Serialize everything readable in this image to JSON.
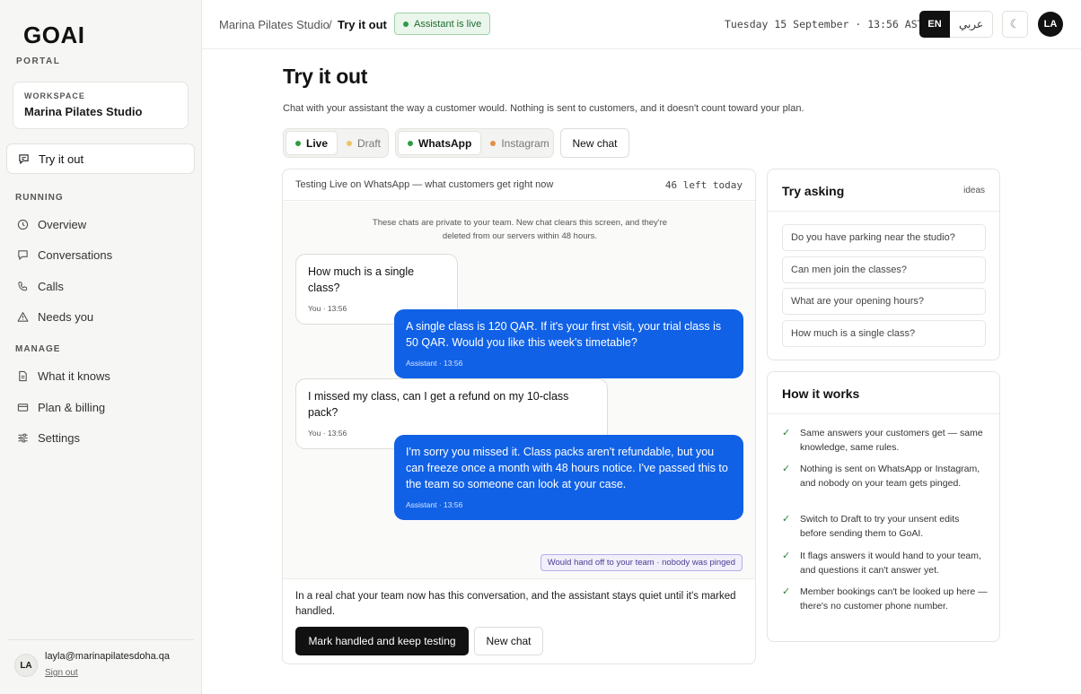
{
  "sidebar": {
    "logo": "GOAI",
    "logo_sub": "PORTAL",
    "workspace_label": "WORKSPACE",
    "workspace_name": "Marina Pilates Studio",
    "active_item": "Try it out",
    "section_running": "RUNNING",
    "running_items": [
      "Overview",
      "Conversations",
      "Calls",
      "Needs you"
    ],
    "section_manage": "MANAGE",
    "manage_items": [
      "What it knows",
      "Plan & billing",
      "Settings"
    ],
    "user_initials": "LA",
    "user_email": "layla@marinapilatesdoha.qa",
    "sign_out": "Sign out"
  },
  "topbar": {
    "crumb_parent": "Marina Pilates Studio",
    "crumb_sep": "/",
    "crumb_current": "Try it out",
    "live_badge": "Assistant is live",
    "datetime": "Tuesday 15 September · 13:56 AST",
    "lang_en": "EN",
    "lang_ar": "عربي",
    "theme_icon": "☾",
    "avatar": "LA"
  },
  "main": {
    "title": "Try it out",
    "subtitle": "Chat with your assistant the way a customer would. Nothing is sent to customers, and it doesn't count toward your plan.",
    "mode_live": "Live",
    "mode_draft": "Draft",
    "channel_whatsapp": "WhatsApp",
    "channel_instagram": "Instagram",
    "new_chat": "New chat"
  },
  "chat": {
    "header": "Testing Live on WhatsApp — what customers get right now",
    "remaining": "46 left today",
    "privacy_line1": "These chats are private to your team. New chat clears this screen, and they're",
    "privacy_line2": "deleted from our servers within 48 hours.",
    "messages": [
      {
        "role": "user",
        "text": "How much is a single class?",
        "meta": "You · 13:56"
      },
      {
        "role": "bot",
        "text": "A single class is 120 QAR. If it's your first visit, your trial class is 50 QAR. Would you like this week's timetable?",
        "meta": "Assistant · 13:56"
      },
      {
        "role": "user",
        "text": "I missed my class, can I get a refund on my 10-class pack?",
        "meta": "You · 13:56"
      },
      {
        "role": "bot",
        "text": "I'm sorry you missed it. Class packs aren't refundable, but you can freeze once a month with 48 hours notice. I've passed this to the team so someone can look at your case.",
        "meta": "Assistant · 13:56"
      }
    ],
    "handoff": "Would hand off to your team · nobody was pinged",
    "footer_note": "In a real chat your team now has this conversation, and the assistant stays quiet until it's marked handled.",
    "btn_mark": "Mark handled and keep testing",
    "btn_new": "New chat"
  },
  "try_asking": {
    "title": "Try asking",
    "aux": "ideas",
    "items": [
      "Do you have parking near the studio?",
      "Can men join the classes?",
      "What are your opening hours?",
      "How much is a single class?"
    ]
  },
  "how_it_works": {
    "title": "How it works",
    "items": [
      "Same answers your customers get — same knowledge, same rules.",
      "Nothing is sent on WhatsApp or Instagram, and nobody on your team gets pinged.",
      "Switch to Draft to try your unsent edits before sending them to GoAI.",
      "It flags answers it would hand to your team, and questions it can't answer yet.",
      "Member bookings can't be looked up here — there's no customer phone number."
    ]
  },
  "colors": {
    "accent_blue": "#1061e6",
    "live_green": "#2e9b47",
    "draft_amber": "#f2c46a",
    "instagram_orange": "#e2904a",
    "handoff_purple": "#b7aee6"
  }
}
